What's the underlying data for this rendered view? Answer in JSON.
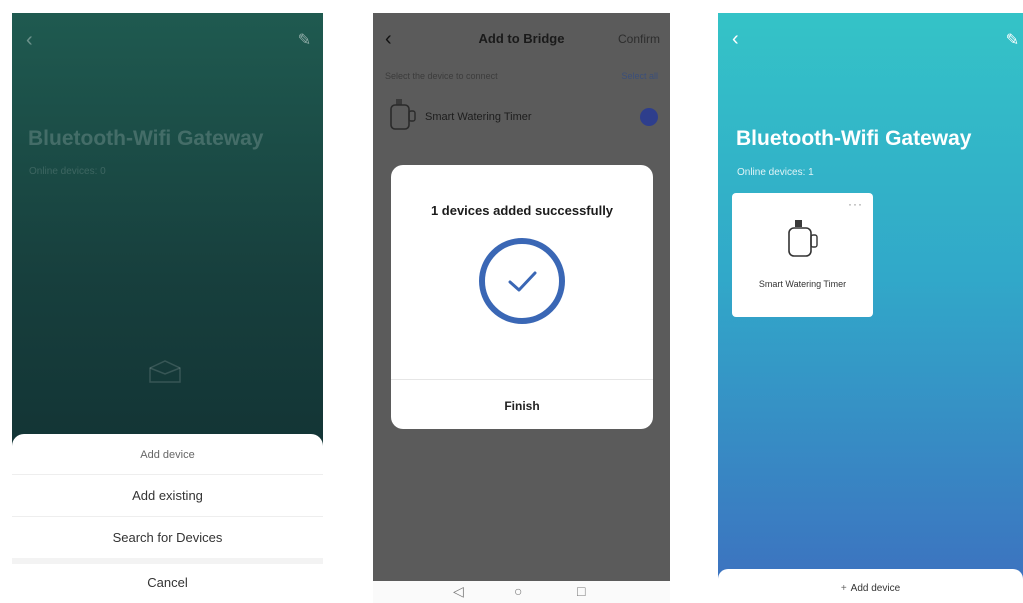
{
  "screen1": {
    "back_icon": "‹",
    "edit_icon": "✎",
    "title": "Bluetooth-Wifi Gateway",
    "online_devices": "Online devices: 0",
    "sheet": {
      "header": "Add device",
      "add_existing": "Add existing",
      "search": "Search for Devices",
      "cancel": "Cancel"
    }
  },
  "screen2": {
    "back_icon": "‹",
    "title": "Add to Bridge",
    "confirm": "Confirm",
    "select_hint": "Select the device to connect",
    "select_all": "Select all",
    "device_name": "Smart Watering Timer",
    "dialog": {
      "message": "1 devices added successfully",
      "finish": "Finish"
    },
    "nav": {
      "back": "◁",
      "home": "○",
      "recent": "□"
    },
    "colors": {
      "check": "#2e3e8c",
      "success_ring": "#3a67b5"
    }
  },
  "screen3": {
    "back_icon": "‹",
    "edit_icon": "✎",
    "title": "Bluetooth-Wifi Gateway",
    "online_devices": "Online devices: 1",
    "card": {
      "more": "···",
      "name": "Smart Watering Timer"
    },
    "add_device_plus": "+",
    "add_device": "Add device"
  }
}
